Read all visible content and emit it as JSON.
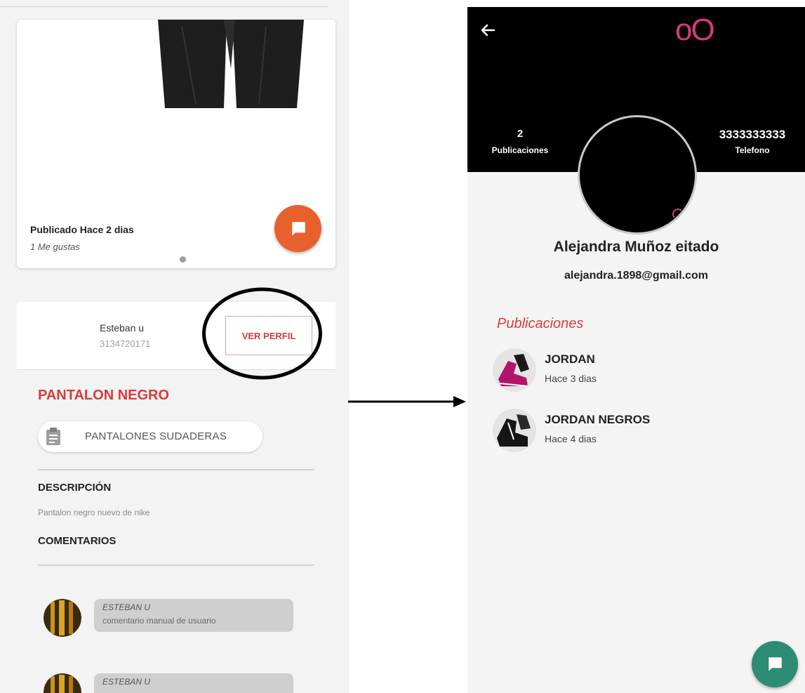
{
  "product_screen": {
    "card": {
      "published": "Publicado Hace 2 dias",
      "likes": "1 Me gustas"
    },
    "seller": {
      "name": "Esteban u",
      "phone": "3134720171",
      "view_profile_label": "VER PERFIL"
    },
    "title": "PANTALON NEGRO",
    "category": "PANTALONES SUDADERAS",
    "description_heading": "DESCRIPCIÓN",
    "description": "Pantalon negro nuevo de nike",
    "comments_heading": "COMENTARIOS",
    "comments": [
      {
        "author": "ESTEBAN U",
        "text": "comentario manual de usuario"
      },
      {
        "author": "ESTEBAN U",
        "text": ""
      }
    ],
    "colors": {
      "accent": "#d83a3a",
      "fab": "#e8612c"
    }
  },
  "profile_screen": {
    "logo": "oO",
    "stats": {
      "publications_count": "2",
      "publications_label": "Publicaciones",
      "phone": "3333333333",
      "phone_label": "Telefono"
    },
    "name": "Alejandra Muñoz eitado",
    "email": "alejandra.1898@gmail.com",
    "publications_heading": "Publicaciones",
    "publications": [
      {
        "title": "JORDAN",
        "date": "Hace 3 dias"
      },
      {
        "title": "JORDAN NEGROS",
        "date": "Hace 4 dias"
      }
    ],
    "colors": {
      "header": "#000000",
      "logo": "#d63a7a",
      "fab": "#2e8c74"
    }
  },
  "icons": {
    "chat": "chat-bubble-icon",
    "back": "arrow-left-icon",
    "category": "clipboard-icon"
  }
}
